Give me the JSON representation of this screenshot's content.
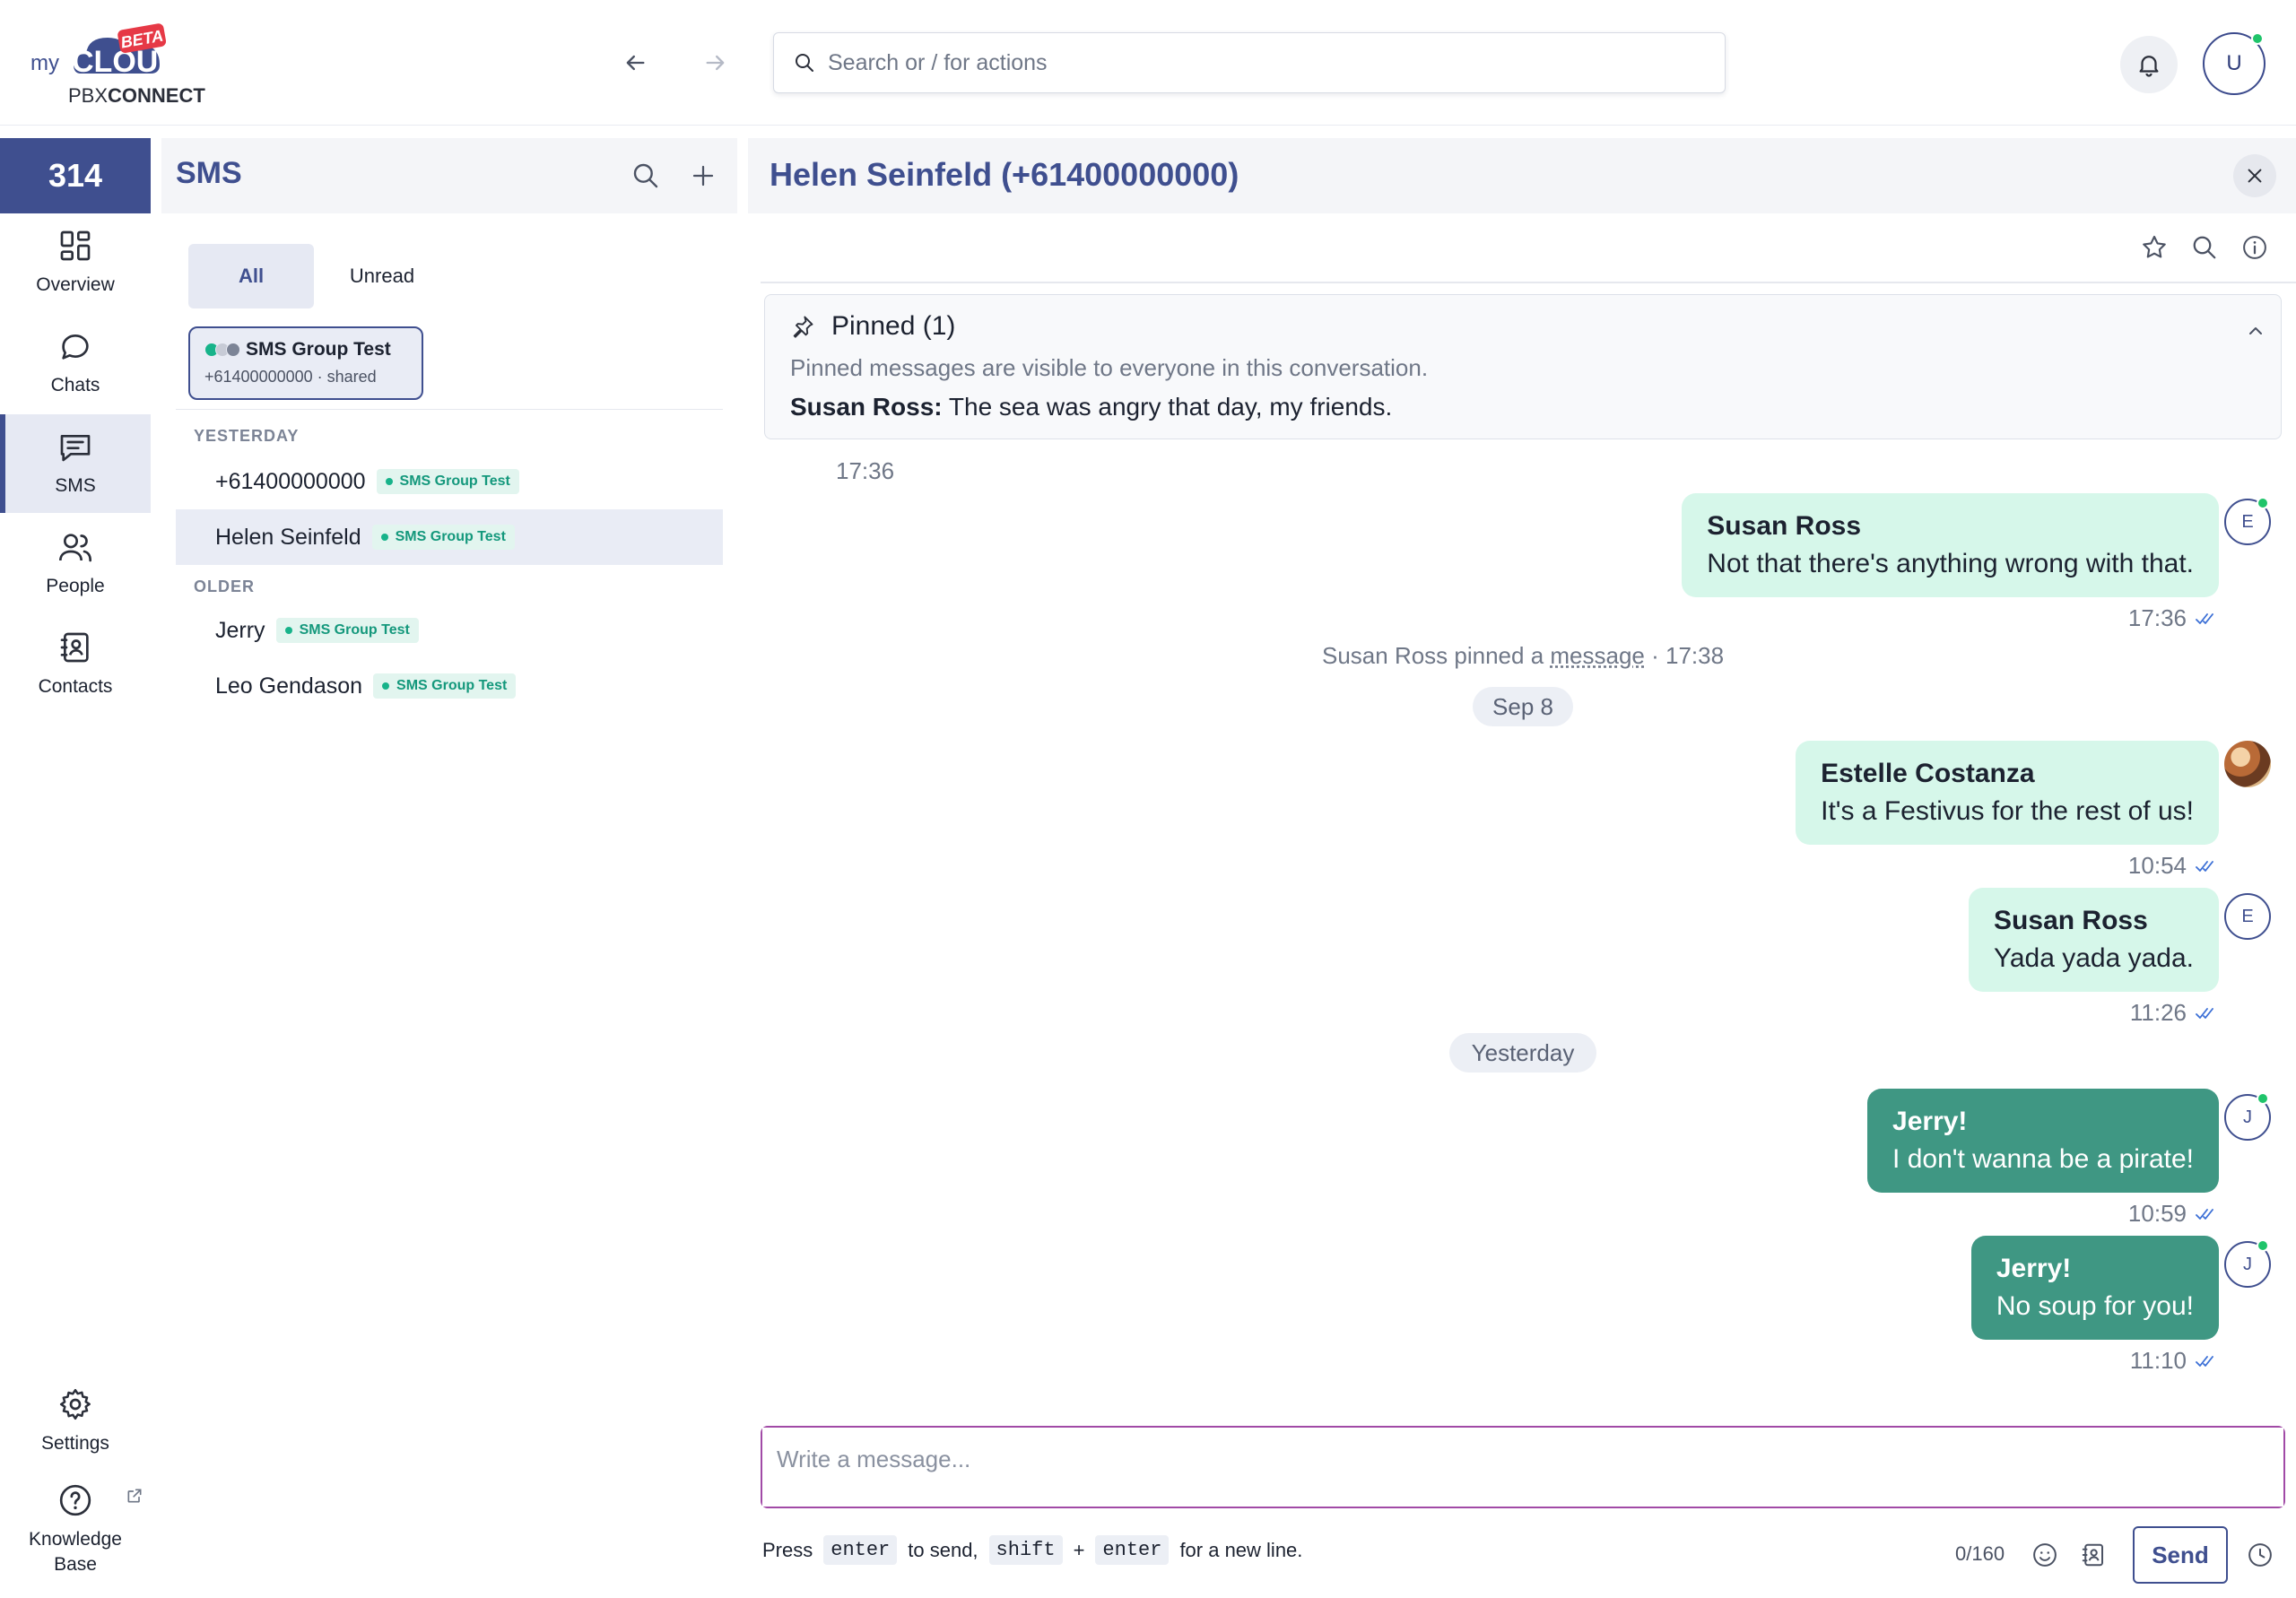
{
  "header": {
    "logo": {
      "prefix": "my",
      "brand": "CLOUD",
      "badge": "BETA",
      "line2a": "PBX",
      "line2b": "CONNECT"
    },
    "search": {
      "placeholder": "Search or / for actions",
      "value": ""
    },
    "user_initial": "U"
  },
  "leftnav": {
    "extension": "314",
    "items": [
      {
        "label": "Overview",
        "icon": "overview-grid-icon"
      },
      {
        "label": "Chats",
        "icon": "chat-bubble-icon"
      },
      {
        "label": "SMS",
        "icon": "sms-icon",
        "active": true
      },
      {
        "label": "People",
        "icon": "people-icon"
      },
      {
        "label": "Contacts",
        "icon": "contacts-book-icon"
      }
    ],
    "bottom": [
      {
        "label": "Settings",
        "icon": "gear-icon"
      },
      {
        "label": "Knowledge Base",
        "icon": "help-circle-icon"
      }
    ]
  },
  "list": {
    "title": "SMS",
    "tabs": [
      {
        "label": "All",
        "active": true
      },
      {
        "label": "Unread"
      }
    ],
    "group_card": {
      "name": "SMS Group Test",
      "sub": "+61400000000 · shared"
    },
    "sections": [
      {
        "label": "YESTERDAY",
        "items": [
          {
            "name": "+61400000000",
            "tag": "SMS Group Test"
          },
          {
            "name": "Helen Seinfeld",
            "tag": "SMS Group Test",
            "active": true
          }
        ]
      },
      {
        "label": "OLDER",
        "items": [
          {
            "name": "Jerry",
            "tag": "SMS Group Test"
          },
          {
            "name": "Leo Gendason",
            "tag": "SMS Group Test"
          }
        ]
      }
    ]
  },
  "chat": {
    "title": "Helen Seinfeld (+61400000000)",
    "pinned": {
      "heading": "Pinned (1)",
      "note": "Pinned messages are visible to everyone in this conversation.",
      "sender": "Susan Ross:",
      "text": "The sea was angry that day, my friends."
    },
    "first_time": "17:36",
    "messages": [
      {
        "sender": "Susan Ross",
        "text": "Not that there's anything wrong with that.",
        "time": "17:36",
        "avatar": "E"
      },
      {
        "sender": "Estelle Costanza",
        "text": "It's a Festivus for the rest of us!",
        "time": "10:54",
        "avatar": ""
      },
      {
        "sender": "Susan Ross",
        "text": "Yada yada yada.",
        "time": "11:26",
        "avatar": "E"
      },
      {
        "sender": "Jerry!",
        "text": "I don't wanna be a pirate!",
        "time": "10:59",
        "avatar": "J"
      },
      {
        "sender": "Jerry!",
        "text": "No soup for you!",
        "time": "11:10",
        "avatar": "J"
      }
    ],
    "system_event": {
      "prefix": "Susan Ross pinned a ",
      "link": "message",
      "suffix": " · 17:38"
    },
    "date_pills": [
      "Sep 8",
      "Yesterday"
    ],
    "composer": {
      "placeholder": "Write a message...",
      "hint_press": "Press",
      "key_enter": "enter",
      "hint_send": "to send,",
      "key_shift": "shift",
      "plus": "+",
      "hint_newline": "for a new line.",
      "counter": "0/160",
      "send_label": "Send"
    }
  },
  "colors": {
    "brand": "#3f4f8f",
    "bubble_light": "#d6f7ea",
    "bubble_dark": "#3f9783",
    "tag_bg": "#e2f5ef",
    "tag_text": "#14987c",
    "composer_border": "#a14aa6",
    "online": "#1fc46a"
  }
}
